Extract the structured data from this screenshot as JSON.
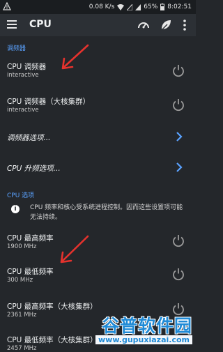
{
  "status_bar": {
    "speed": "0.08 K/s",
    "battery": "65%",
    "time": "8:02:51"
  },
  "toolbar": {
    "title": "CPU",
    "icons": [
      "menu-icon",
      "gauge-icon",
      "leaf-icon",
      "more-vert-icon"
    ]
  },
  "sections": [
    {
      "header": "调频器"
    },
    {
      "header": "CPU 选项"
    }
  ],
  "governor": {
    "items": [
      {
        "title": "CPU 调频器",
        "subtitle": "interactive"
      },
      {
        "title": "CPU 调频器（大核集群）",
        "subtitle": "interactive"
      }
    ],
    "links": [
      {
        "title": "调频器选项..."
      },
      {
        "title": "CPU 升频选项..."
      }
    ]
  },
  "cpu_options": {
    "info": "CPU 频率和核心受系统进程控制。因而这些设置项可能无法持续。",
    "items": [
      {
        "title": "CPU 最高频率",
        "subtitle": "1900 MHz"
      },
      {
        "title": "CPU 最低频率",
        "subtitle": "300 MHz"
      },
      {
        "title": "CPU 最高频率（大核集群）",
        "subtitle": "2361 MHz"
      },
      {
        "title": "CPU 最低频率（大核集群）",
        "subtitle": "2457 MHz"
      }
    ]
  },
  "watermark": {
    "main": "谷普软件园",
    "url": "www.gupuxiazai.com"
  },
  "colors": {
    "background": "#24272b",
    "toolbar": "#2c3035",
    "accent": "#5aa2ff",
    "arrow": "#e5322d"
  }
}
